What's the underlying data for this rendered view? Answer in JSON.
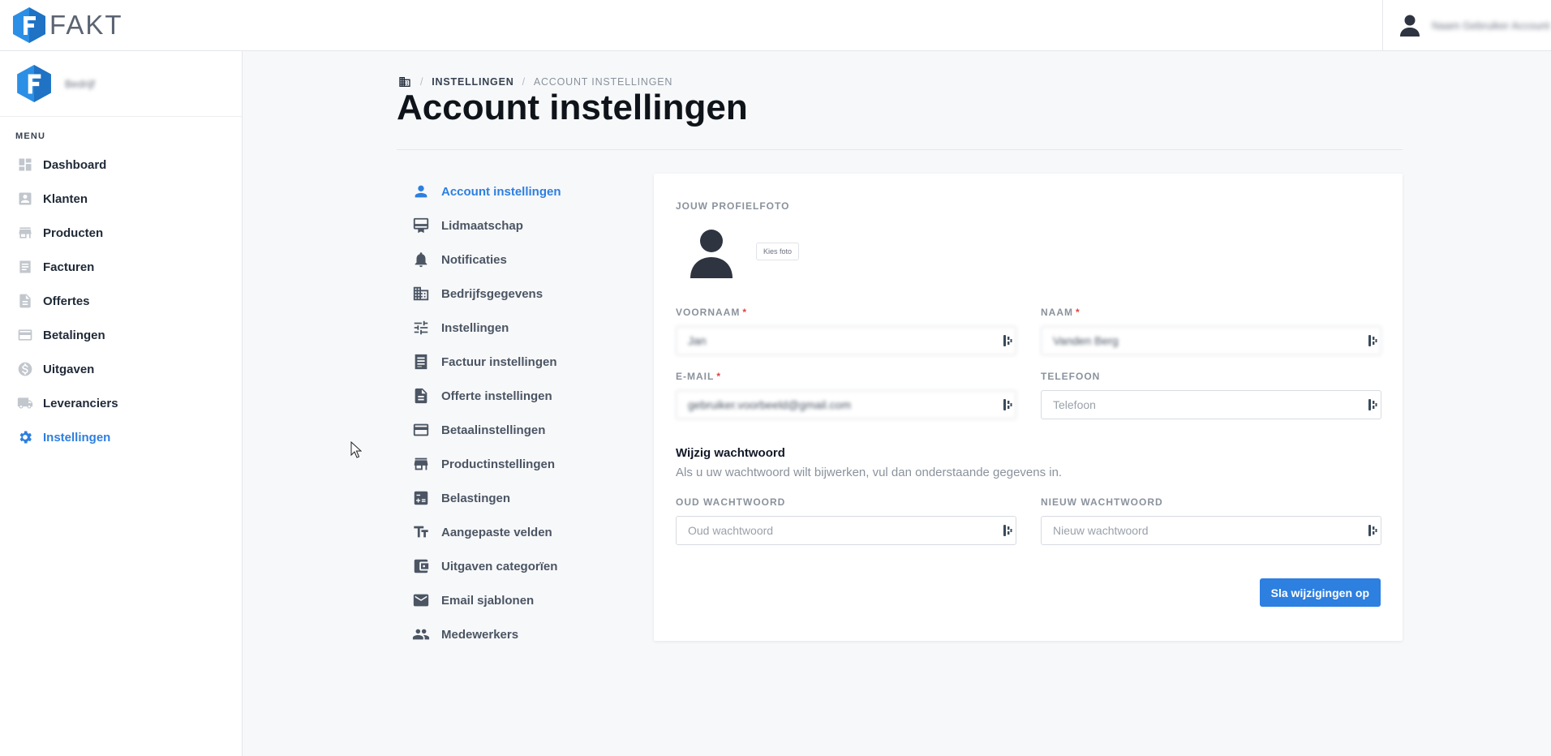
{
  "app": {
    "name": "FAKT",
    "user_name": "Naam Gebruiker Account"
  },
  "company": {
    "name": "Bedrijf"
  },
  "sidebar": {
    "menu_label": "MENU",
    "items": [
      {
        "label": "Dashboard",
        "icon": "dashboard-icon"
      },
      {
        "label": "Klanten",
        "icon": "contact-icon"
      },
      {
        "label": "Producten",
        "icon": "store-icon"
      },
      {
        "label": "Facturen",
        "icon": "list-icon"
      },
      {
        "label": "Offertes",
        "icon": "document-icon"
      },
      {
        "label": "Betalingen",
        "icon": "credit-card-icon"
      },
      {
        "label": "Uitgaven",
        "icon": "dollar-icon"
      },
      {
        "label": "Leveranciers",
        "icon": "truck-icon"
      },
      {
        "label": "Instellingen",
        "icon": "gear-icon",
        "active": true
      }
    ]
  },
  "breadcrumb": {
    "level1": "INSTELLINGEN",
    "level2": "ACCOUNT INSTELLINGEN"
  },
  "page": {
    "title": "Account instellingen"
  },
  "settings_nav": {
    "items": [
      {
        "label": "Account instellingen",
        "icon": "person-icon",
        "active": true
      },
      {
        "label": "Lidmaatschap",
        "icon": "card-membership-icon"
      },
      {
        "label": "Notificaties",
        "icon": "bell-icon"
      },
      {
        "label": "Bedrijfsgegevens",
        "icon": "building-icon"
      },
      {
        "label": "Instellingen",
        "icon": "sliders-icon"
      },
      {
        "label": "Factuur instellingen",
        "icon": "invoice-icon"
      },
      {
        "label": "Offerte instellingen",
        "icon": "document-icon"
      },
      {
        "label": "Betaalinstellingen",
        "icon": "credit-card-icon"
      },
      {
        "label": "Productinstellingen",
        "icon": "store-icon"
      },
      {
        "label": "Belastingen",
        "icon": "calculator-icon"
      },
      {
        "label": "Aangepaste velden",
        "icon": "text-fields-icon"
      },
      {
        "label": "Uitgaven categorïen",
        "icon": "wallet-icon"
      },
      {
        "label": "Email sjablonen",
        "icon": "mail-icon"
      },
      {
        "label": "Medewerkers",
        "icon": "people-icon"
      }
    ]
  },
  "form": {
    "photo_label": "JOUW PROFIELFOTO",
    "choose_photo": "Kies foto",
    "required_mark": "*",
    "first_name": {
      "label": "VOORNAAM",
      "value": "Jan"
    },
    "last_name": {
      "label": "NAAM",
      "value": "Vanden Berg"
    },
    "email": {
      "label": "E-MAIL",
      "value": "gebruiker.voorbeeld@gmail.com"
    },
    "phone": {
      "label": "TELEFOON",
      "placeholder": "Telefoon"
    },
    "password_section": {
      "title": "Wijzig wachtwoord",
      "hint": "Als u uw wachtwoord wilt bijwerken, vul dan onderstaande gegevens in.",
      "old": {
        "label": "OUD WACHTWOORD",
        "placeholder": "Oud wachtwoord"
      },
      "new": {
        "label": "NIEUW WACHTWOORD",
        "placeholder": "Nieuw wachtwoord"
      }
    },
    "save_label": "Sla wijzigingen op"
  },
  "colors": {
    "accent": "#2d7fe0",
    "required": "#e53e3e"
  }
}
